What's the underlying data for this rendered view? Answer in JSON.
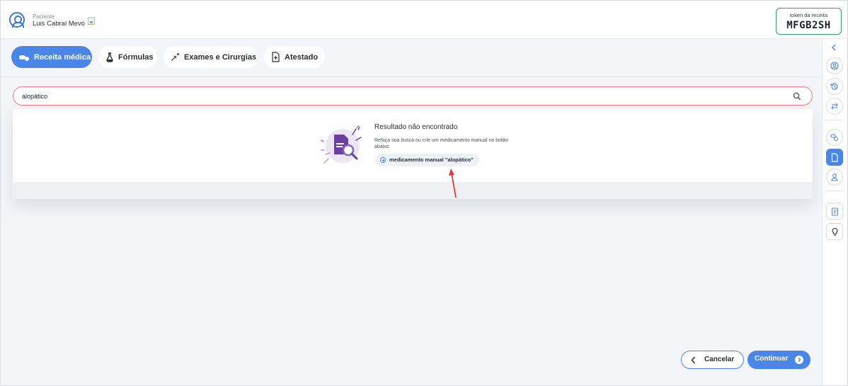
{
  "header": {
    "patient_label": "Paciente",
    "patient_name": "Luis Cabral Mevo",
    "token_label": "token da receita",
    "token_code": "MFGB2SH"
  },
  "tabs": [
    {
      "label": "Receita médica",
      "active": true,
      "icon": "pills-icon"
    },
    {
      "label": "Fórmulas",
      "active": false,
      "icon": "flask-icon"
    },
    {
      "label": "Exames e Cirurgias",
      "active": false,
      "icon": "syringe-icon"
    },
    {
      "label": "Atestado",
      "active": false,
      "icon": "document-plus-icon"
    }
  ],
  "search": {
    "value": "alopático",
    "icon": "search-icon"
  },
  "not_found": {
    "title": "Resultado não encontrado",
    "description": "Refaça sua busca ou crie um medicamento manual no botão abaixo",
    "manual_button_label": "medicamento manual \"alopático\""
  },
  "rail": {
    "icons": [
      "collapse-chevron-icon",
      "patient-icon",
      "history-icon",
      "swap-icon",
      "medications-icon",
      "document-icon",
      "doctor-icon",
      "clipboard-icon",
      "lightbulb-icon"
    ]
  },
  "footer": {
    "cancel_label": "Cancelar",
    "continue_label": "Continuar"
  },
  "colors": {
    "accent": "#4a86e8",
    "token_border": "#35a06a",
    "search_border": "#f07c7c",
    "arrow": "#e53935",
    "illustration_purple": "#6b3fa0"
  }
}
